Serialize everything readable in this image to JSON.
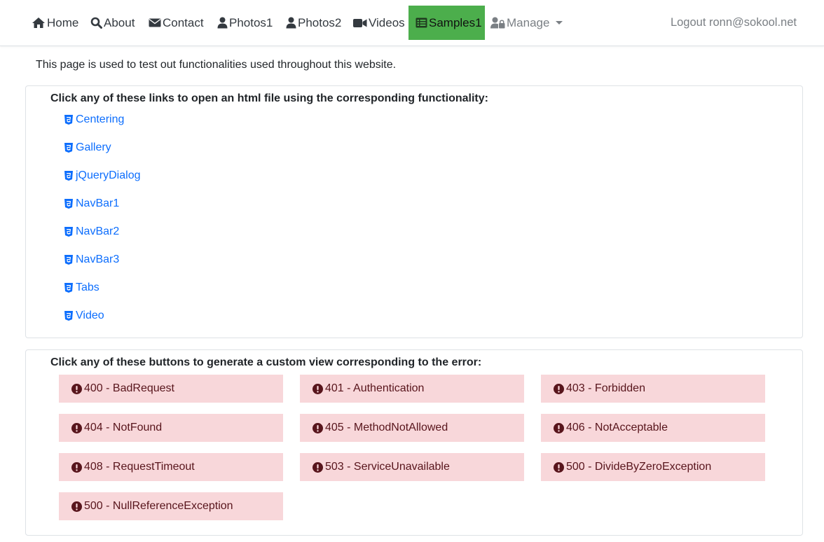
{
  "nav": {
    "items": [
      {
        "label": "Home",
        "icon": "home-icon"
      },
      {
        "label": "About",
        "icon": "search-icon"
      },
      {
        "label": "Contact",
        "icon": "envelope-icon"
      },
      {
        "label": "Photos1",
        "icon": "user-icon"
      },
      {
        "label": "Photos2",
        "icon": "user-icon"
      },
      {
        "label": "Videos",
        "icon": "video-camera-icon"
      },
      {
        "label": "Samples1",
        "icon": "list-icon",
        "active": true
      },
      {
        "label": "Manage",
        "icon": "user-lock-icon",
        "dropdown": true
      }
    ],
    "logout": "Logout ronn@sokool.net"
  },
  "intro": "This page is used to test out functionalities used throughout this website.",
  "links_section": {
    "title": "Click any of these links to open an html file using the corresponding functionality:",
    "links": [
      "Centering",
      "Gallery",
      "jQueryDialog",
      "NavBar1",
      "NavBar2",
      "NavBar3",
      "Tabs",
      "Video"
    ]
  },
  "errors_section": {
    "title": "Click any of these buttons to generate a custom view corresponding to the error:",
    "buttons": [
      "400 - BadRequest",
      "401 - Authentication",
      "403 - Forbidden",
      "404 - NotFound",
      "405 - MethodNotAllowed",
      "406 - NotAcceptable",
      "408 - RequestTimeout",
      "503 - ServiceUnavailable",
      "500 - DivideByZeroException",
      "500 - NullReferenceException"
    ]
  },
  "colors": {
    "active_nav_bg": "#4cae4c",
    "link": "#0d6efd",
    "error_bg": "#f8d7da",
    "error_text": "#58151c"
  }
}
